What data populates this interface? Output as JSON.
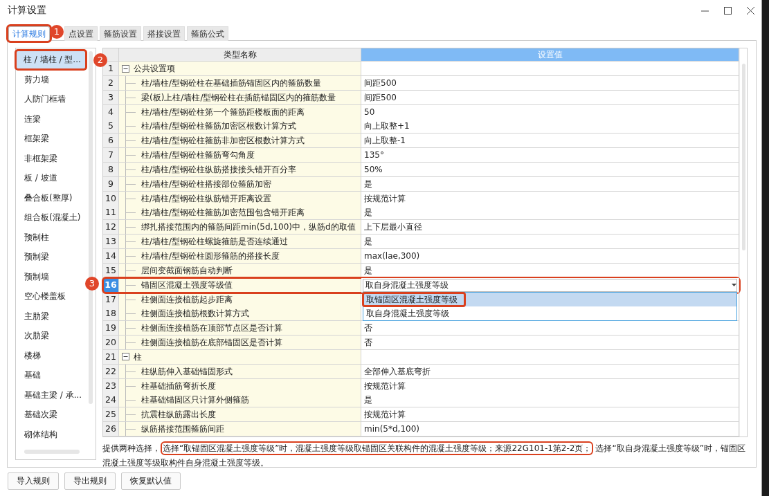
{
  "window": {
    "title": "计算设置"
  },
  "tabs": [
    {
      "label": "计算规则",
      "selected": true,
      "marker": "1"
    },
    {
      "label": "点设置",
      "selected": false
    },
    {
      "label": "箍筋设置",
      "selected": false
    },
    {
      "label": "搭接设置",
      "selected": false
    },
    {
      "label": "箍筋公式",
      "selected": false
    }
  ],
  "sidebar": {
    "items": [
      {
        "label": "柱 / 墙柱 / 型...",
        "selected": true,
        "marker": "2"
      },
      {
        "label": "剪力墙",
        "selected": false
      },
      {
        "label": "人防门框墙",
        "selected": false
      },
      {
        "label": "连梁",
        "selected": false
      },
      {
        "label": "框架梁",
        "selected": false
      },
      {
        "label": "非框架梁",
        "selected": false
      },
      {
        "label": "板 / 坡道",
        "selected": false
      },
      {
        "label": "叠合板(整厚)",
        "selected": false
      },
      {
        "label": "组合板(混凝土)",
        "selected": false
      },
      {
        "label": "预制柱",
        "selected": false
      },
      {
        "label": "预制梁",
        "selected": false
      },
      {
        "label": "预制墙",
        "selected": false
      },
      {
        "label": "空心楼盖板",
        "selected": false
      },
      {
        "label": "主肋梁",
        "selected": false
      },
      {
        "label": "次肋梁",
        "selected": false
      },
      {
        "label": "楼梯",
        "selected": false
      },
      {
        "label": "基础",
        "selected": false
      },
      {
        "label": "基础主梁 / 承...",
        "selected": false
      },
      {
        "label": "基础次梁",
        "selected": false
      },
      {
        "label": "砌体结构",
        "selected": false
      }
    ]
  },
  "table": {
    "columns": [
      {
        "label": "类型名称",
        "selected": false
      },
      {
        "label": "设置值",
        "selected": true
      }
    ],
    "rows": [
      {
        "num": "1",
        "kind": "group",
        "expanded": true,
        "name": "公共设置项",
        "selected": false
      },
      {
        "num": "2",
        "kind": "item",
        "name": "柱/墙柱/型钢砼柱在基础插筋锚固区内的箍筋数量",
        "value": "间距500",
        "selected": false
      },
      {
        "num": "3",
        "kind": "item",
        "name": "梁(板)上柱/墙柱/型钢砼柱在插筋锚固区内的箍筋数量",
        "value": "间距500",
        "selected": false
      },
      {
        "num": "4",
        "kind": "item",
        "name": "柱/墙柱/型钢砼柱第一个箍筋距楼板面的距离",
        "value": "50",
        "selected": false
      },
      {
        "num": "5",
        "kind": "item",
        "name": "柱/墙柱/型钢砼柱箍筋加密区根数计算方式",
        "value": "向上取整+1",
        "selected": false
      },
      {
        "num": "6",
        "kind": "item",
        "name": "柱/墙柱/型钢砼柱箍筋非加密区根数计算方式",
        "value": "向上取整-1",
        "selected": false
      },
      {
        "num": "7",
        "kind": "item",
        "name": "柱/墙柱/型钢砼柱箍筋弯勾角度",
        "value": "135°",
        "selected": false
      },
      {
        "num": "8",
        "kind": "item",
        "name": "柱/墙柱/型钢砼柱纵筋搭接接头错开百分率",
        "value": "50%",
        "selected": false
      },
      {
        "num": "9",
        "kind": "item",
        "name": "柱/墙柱/型钢砼柱搭接部位箍筋加密",
        "value": "是",
        "selected": false
      },
      {
        "num": "10",
        "kind": "item",
        "name": "柱/墙柱/型钢砼柱纵筋错开距离设置",
        "value": "按规范计算",
        "selected": false
      },
      {
        "num": "11",
        "kind": "item",
        "name": "柱/墙柱/型钢砼柱箍筋加密范围包含错开距离",
        "value": "是",
        "selected": false
      },
      {
        "num": "12",
        "kind": "item",
        "name": "绑扎搭接范围内的箍筋间距min(5d,100)中，纵筋d的取值",
        "value": "上下层最小直径",
        "selected": false
      },
      {
        "num": "13",
        "kind": "item",
        "name": "柱/墙柱/型钢砼柱螺旋箍筋是否连续通过",
        "value": "是",
        "selected": false
      },
      {
        "num": "14",
        "kind": "item",
        "name": "柱/墙柱/型钢砼柱圆形箍筋的搭接长度",
        "value": "max(lae,300)",
        "selected": false
      },
      {
        "num": "15",
        "kind": "item",
        "name": "层间变截面钢筋自动判断",
        "value": "是",
        "selected": false
      },
      {
        "num": "16",
        "kind": "item",
        "name": "锚固区混凝土强度等级值",
        "selected": true,
        "marker": "3",
        "dropdown": {
          "value": "取自身混凝土强度等级",
          "options": [
            {
              "label": "取锚固区混凝土强度等级",
              "highlighted": true,
              "callout": true
            },
            {
              "label": "取自身混凝土强度等级",
              "highlighted": false
            }
          ]
        }
      },
      {
        "num": "17",
        "kind": "item",
        "name": "柱侧面连接植筋起步距离",
        "selected": false
      },
      {
        "num": "18",
        "kind": "item",
        "name": "柱侧面连接植筋根数计算方式",
        "selected": false
      },
      {
        "num": "19",
        "kind": "item",
        "name": "柱侧面连接植筋在顶部节点区是否计算",
        "value": "否",
        "selected": false
      },
      {
        "num": "20",
        "kind": "item",
        "name": "柱侧面连接植筋在底部锚固区是否计算",
        "value": "否",
        "selected": false
      },
      {
        "num": "21",
        "kind": "group",
        "expanded": true,
        "name": "柱",
        "selected": false
      },
      {
        "num": "22",
        "kind": "item",
        "name": "柱纵筋伸入基础锚固形式",
        "value": "全部伸入基底弯折",
        "selected": false
      },
      {
        "num": "23",
        "kind": "item",
        "name": "柱基础插筋弯折长度",
        "value": "按规范计算",
        "selected": false
      },
      {
        "num": "24",
        "kind": "item",
        "name": "柱基础锚固区只计算外侧箍筋",
        "value": "是",
        "selected": false
      },
      {
        "num": "25",
        "kind": "item",
        "name": "抗震柱纵筋露出长度",
        "value": "按规范计算",
        "selected": false
      },
      {
        "num": "26",
        "kind": "item",
        "name": "纵筋搭接范围箍筋间距",
        "value": "min(5*d,100)",
        "selected": false
      }
    ]
  },
  "description": {
    "parts": [
      {
        "text": "提供两种选择，",
        "callout": false
      },
      {
        "text": "选择“取锚固区混凝土强度等级”时，混凝土强度等级取锚固区关联构件的混凝土强度等级；来源22G101-1第2-2页；",
        "callout": true
      },
      {
        "text": "选择“取自身混凝土强度等级”时，锚固区混凝土强度等级取构件自身混凝土强度等级。",
        "callout": false
      }
    ]
  },
  "buttons": [
    "导入规则",
    "导出规则",
    "恢复默认值"
  ]
}
